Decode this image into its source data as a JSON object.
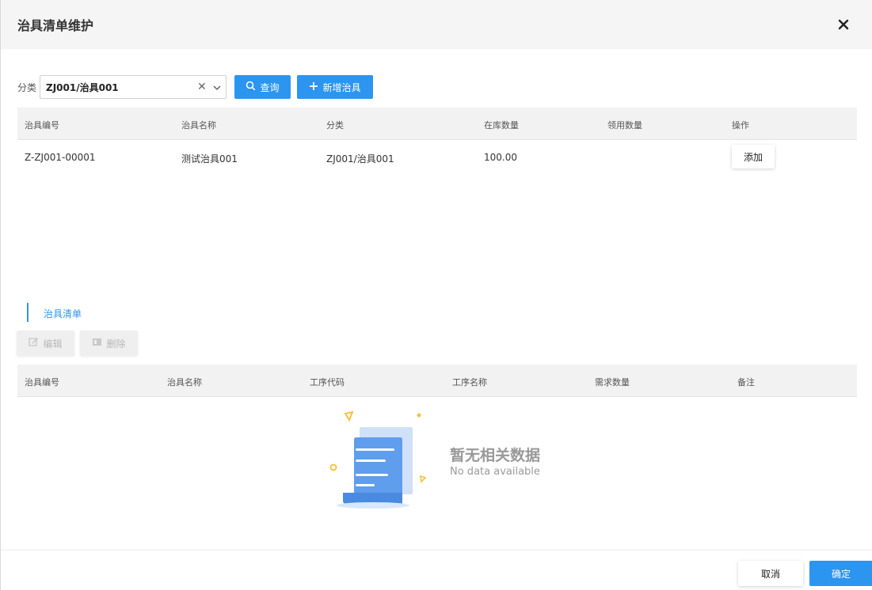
{
  "dialog": {
    "title": "治具清单维护",
    "close_icon": "close-icon"
  },
  "filter": {
    "label": "分类",
    "category_value": "ZJ001/治具001",
    "query_label": "查询",
    "add_tool_label": "新增治具"
  },
  "tool_table": {
    "headers": [
      "治具编号",
      "治具名称",
      "分类",
      "在库数量",
      "领用数量",
      "操作"
    ],
    "rows": [
      {
        "code": "Z-ZJ001-00001",
        "name": "测试治具001",
        "category": "ZJ001/治具001",
        "stock_qty": "100.00",
        "issued_qty": "",
        "action_label": "添加"
      }
    ]
  },
  "tool_list": {
    "section_title": "治具清单",
    "edit_label": "编辑",
    "delete_label": "删除",
    "headers": [
      "治具编号",
      "治具名称",
      "工序代码",
      "工序名称",
      "需求数量",
      "备注"
    ],
    "empty_title": "暂无相关数据",
    "empty_subtitle": "No data available"
  },
  "footer": {
    "cancel_label": "取消",
    "ok_label": "确定"
  },
  "colors": {
    "primary": "#2b95f0",
    "header_bg": "#f5f5f5",
    "table_header_bg": "#f2f2f2"
  }
}
